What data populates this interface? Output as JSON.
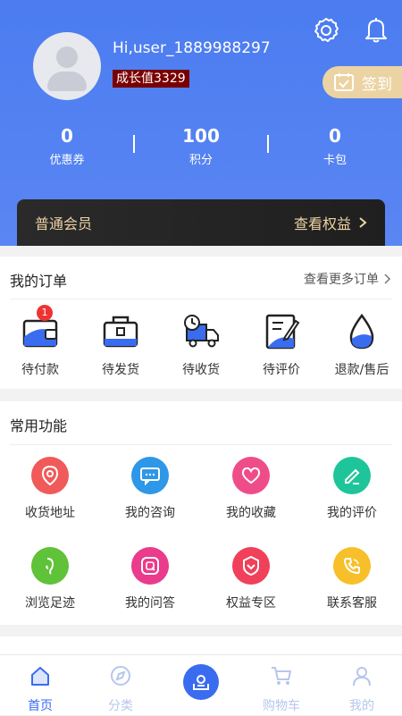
{
  "profile": {
    "username": "Hi,user_1889988297",
    "growth_value": "成长值3329",
    "signin_label": "签到"
  },
  "stats": [
    {
      "value": "0",
      "label": "优惠券"
    },
    {
      "value": "100",
      "label": "积分"
    },
    {
      "value": "0",
      "label": "卡包"
    }
  ],
  "member": {
    "level": "普通会员",
    "rights_label": "查看权益"
  },
  "orders": {
    "title": "我的订单",
    "more_label": "查看更多订单",
    "items": [
      {
        "label": "待付款",
        "badge": "1"
      },
      {
        "label": "待发货"
      },
      {
        "label": "待收货"
      },
      {
        "label": "待评价"
      },
      {
        "label": "退款/售后"
      }
    ]
  },
  "functions": {
    "title": "常用功能",
    "items": [
      {
        "label": "收货地址",
        "icon": "location-icon",
        "color": "#f05a5a"
      },
      {
        "label": "我的咨询",
        "icon": "chat-icon",
        "color": "#2f97e8"
      },
      {
        "label": "我的收藏",
        "icon": "heart-icon",
        "color": "#ef4d8a"
      },
      {
        "label": "我的评价",
        "icon": "pencil-icon",
        "color": "#1fc59a"
      },
      {
        "label": "浏览足迹",
        "icon": "footprint-icon",
        "color": "#5fc238"
      },
      {
        "label": "我的问答",
        "icon": "qa-icon",
        "color": "#ea3b8c"
      },
      {
        "label": "权益专区",
        "icon": "shield-icon",
        "color": "#f0405a"
      },
      {
        "label": "联系客服",
        "icon": "phone-icon",
        "color": "#f7c02a"
      }
    ]
  },
  "tabbar": {
    "items": [
      {
        "label": "首页",
        "active": true
      },
      {
        "label": "分类"
      },
      {
        "label": ""
      },
      {
        "label": "购物车"
      },
      {
        "label": "我的"
      }
    ]
  },
  "colors": {
    "header_blue": "#4b7cf0",
    "gold": "#ecd3a3",
    "tab_active": "#3a6cf0"
  }
}
